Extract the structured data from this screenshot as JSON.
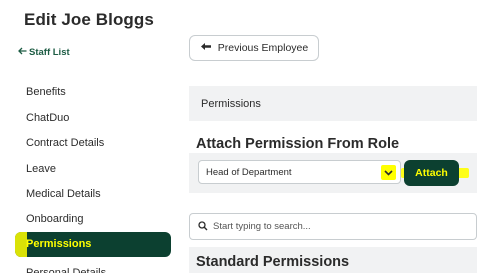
{
  "page": {
    "title": "Edit Joe Bloggs"
  },
  "back_link": {
    "label": "Staff List"
  },
  "sidebar": {
    "items": [
      {
        "label": "Benefits"
      },
      {
        "label": "ChatDuo"
      },
      {
        "label": "Contract Details"
      },
      {
        "label": "Leave"
      },
      {
        "label": "Medical Details"
      },
      {
        "label": "Onboarding"
      },
      {
        "label": "Permissions",
        "active": true
      },
      {
        "label": "Personal Details"
      }
    ]
  },
  "prev_button": {
    "label": "Previous Employee"
  },
  "permissions_header": {
    "label": "Permissions"
  },
  "attach_section": {
    "title": "Attach Permission From Role",
    "selected_role": "Head of Department",
    "attach_label": "Attach"
  },
  "search": {
    "placeholder": "Start typing to search..."
  },
  "standard_section": {
    "title": "Standard Permissions"
  },
  "colors": {
    "brand_dark": "#0c4030",
    "highlight": "#ffff00",
    "link": "#1d5c44",
    "panel": "#f1f2f3"
  },
  "icons": {
    "back": "arrow-left-icon",
    "prev": "arrow-left-icon",
    "select": "chevron-down-icon",
    "search": "search-icon"
  }
}
